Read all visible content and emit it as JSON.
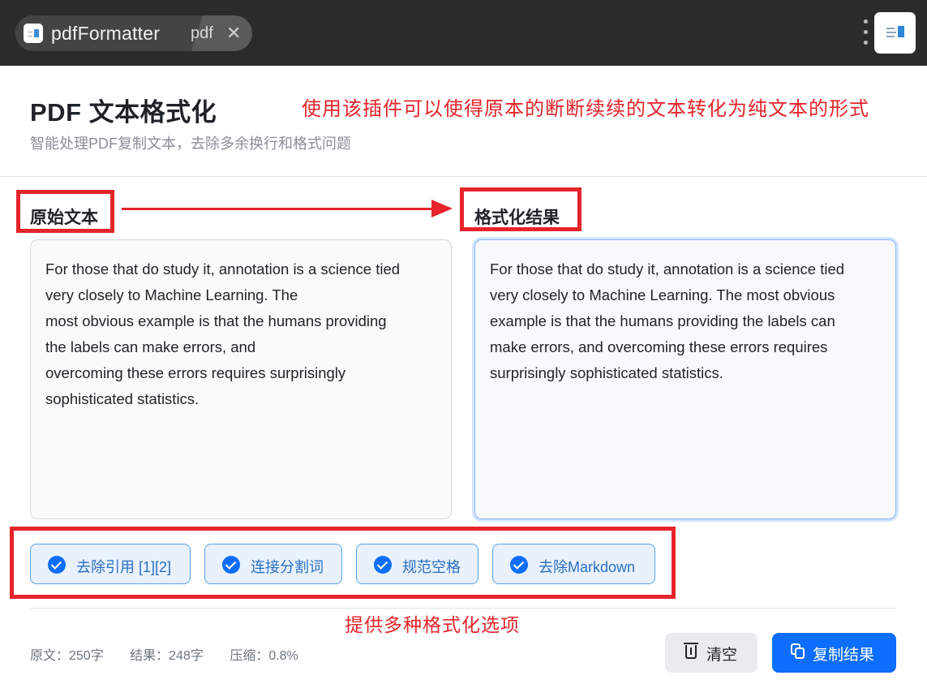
{
  "window": {
    "tab_title": "pdfFormatter",
    "tab_page": "pdf",
    "close_glyph": "✕",
    "icons": [
      "app-logo-icon",
      "close-icon",
      "more-options-icon",
      "extension-icon"
    ]
  },
  "header": {
    "title": "PDF 文本格式化",
    "subtitle": "智能处理PDF复制文本，去除多余换行和格式问题"
  },
  "annotations": {
    "top_note": "使用该插件可以使得原本的断断续续的文本转化为纯文本的形式",
    "bottom_note": "提供多种格式化选项",
    "color": "#e5242b"
  },
  "source": {
    "label": "原始文本",
    "lines": [
      "For those that do study it, annotation is a science tied",
      "very closely to Machine Learning. The",
      "most obvious example is that the humans providing",
      "the labels can make errors, and",
      "overcoming these errors requires surprisingly",
      "sophisticated statistics."
    ]
  },
  "result": {
    "label": "格式化结果",
    "lines": [
      "For those that do study it, annotation is a science tied",
      "very closely to Machine Learning. The most obvious",
      "example is that the humans providing the labels can",
      "make errors, and overcoming these errors requires",
      "surprisingly sophisticated statistics."
    ]
  },
  "options": [
    {
      "label": "去除引用 [1][2]",
      "checked": true
    },
    {
      "label": "连接分割词",
      "checked": true
    },
    {
      "label": "规范空格",
      "checked": true
    },
    {
      "label": "去除Markdown",
      "checked": true
    }
  ],
  "stats": {
    "original": "原文：250字",
    "result": "结果：248字",
    "compression": "压缩：0.8%"
  },
  "actions": {
    "clear_label": "清空",
    "copy_label": "复制结果"
  },
  "colors": {
    "accent": "#0d6efd",
    "chip_bg": "#e8f1fd",
    "chip_border": "#5aa0ec",
    "topbar": "#2b2b2b"
  }
}
